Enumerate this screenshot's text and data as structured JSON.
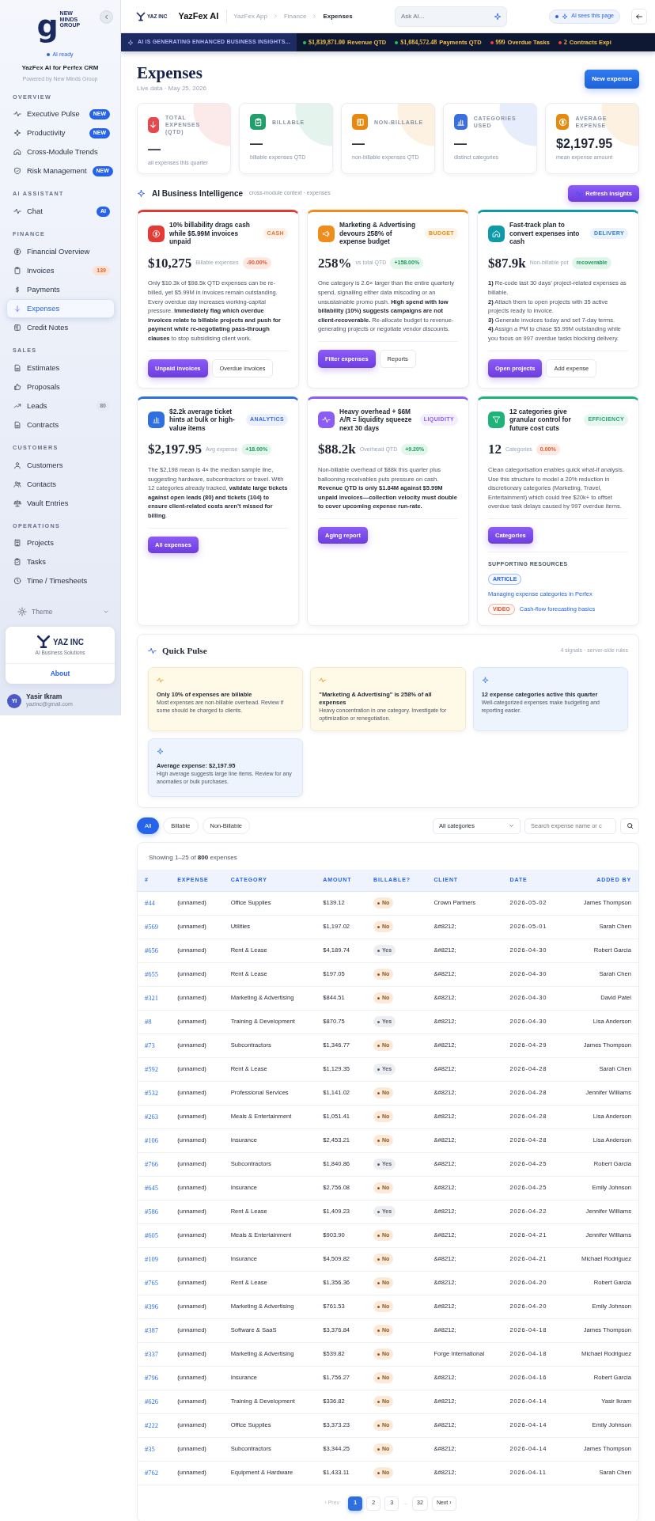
{
  "sidebar": {
    "logo": {
      "mark": "g",
      "text": "NEW MINDS GROUP"
    },
    "status": "AI ready",
    "app_name": "YazFex AI for Perfex CRM",
    "powered_by": "Powered by New Minds Group",
    "sections": [
      {
        "title": "OVERVIEW",
        "items": [
          {
            "label": "Executive Pulse",
            "selected": false,
            "badge": {
              "text": "NEW",
              "color": "#2563eb"
            }
          },
          {
            "label": "Productivity",
            "selected": false,
            "badge": {
              "text": "NEW",
              "color": "#2563eb"
            }
          },
          {
            "label": "Cross-Module Trends",
            "selected": false
          },
          {
            "label": "Risk Management",
            "selected": false,
            "badge": {
              "text": "NEW",
              "color": "#2563eb"
            }
          }
        ]
      },
      {
        "title": "AI ASSISTANT",
        "items": [
          {
            "label": "Chat",
            "selected": false,
            "badge": {
              "text": "AI",
              "color": "#2563eb"
            }
          }
        ]
      },
      {
        "title": "FINANCE",
        "items": [
          {
            "label": "Financial Overview",
            "selected": false
          },
          {
            "label": "Invoices",
            "selected": false,
            "badge": {
              "text": "139",
              "color": "#fbe2d3"
            }
          },
          {
            "label": "Payments",
            "selected": false
          },
          {
            "label": "Expenses",
            "selected": true
          },
          {
            "label": "Credit Notes",
            "selected": false
          }
        ]
      },
      {
        "title": "SALES",
        "items": [
          {
            "label": "Estimates",
            "selected": false
          },
          {
            "label": "Proposals",
            "selected": false
          },
          {
            "label": "Leads",
            "selected": false,
            "badge": {
              "text": "80",
              "color": "#e4e9f5"
            }
          },
          {
            "label": "Contracts",
            "selected": false
          }
        ]
      },
      {
        "title": "CUSTOMERS",
        "items": [
          {
            "label": "Customers",
            "selected": false
          },
          {
            "label": "Contacts",
            "selected": false
          },
          {
            "label": "Vault Entries",
            "selected": false
          }
        ]
      },
      {
        "title": "OPERATIONS",
        "items": [
          {
            "label": "Projects",
            "selected": false
          },
          {
            "label": "Tasks",
            "selected": false
          },
          {
            "label": "Time / Timesheets",
            "selected": false
          }
        ]
      }
    ],
    "theme_label": "Theme",
    "company": {
      "name": "YAZ INC",
      "tagline": "AI Business Solutions",
      "link": "About"
    },
    "user": {
      "initials": "YI",
      "name": "Yasir Ikram",
      "email": "yazinc@gmail.com"
    }
  },
  "header": {
    "logo_text": "YAZ INC",
    "app_title": "YazFex AI",
    "breadcrumb": [
      "YazFex App",
      "Finance",
      "Expenses"
    ],
    "search": {
      "placeholder": "Ask AI..."
    },
    "context_pill": "AI sees this page"
  },
  "ticker": {
    "label": "AI IS GENERATING ENHANCED BUSINESS INSIGHTS...",
    "items": [
      {
        "value": "$1,839,871.00",
        "label": "Revenue QTD",
        "color": "#22c55e"
      },
      {
        "value": "$1,084,572.48",
        "label": "Payments QTD",
        "color": "#22c55e"
      },
      {
        "value": "999",
        "label": "Overdue Tasks",
        "color": "#ef4444"
      },
      {
        "value": "2",
        "label": "Contracts Expi",
        "color": "#ef4444"
      }
    ]
  },
  "page": {
    "title": "Expenses",
    "subtitle": "Live data · May 25, 2026",
    "primary_button": "New expense"
  },
  "kpis": [
    {
      "label": "TOTAL EXPENSES (QTD)",
      "value": "—",
      "caption": "all expenses this quarter",
      "color": "#e5484d"
    },
    {
      "label": "BILLABLE",
      "value": "—",
      "caption": "billable expenses QTD",
      "color": "#22a06b"
    },
    {
      "label": "NON-BILLABLE",
      "value": "—",
      "caption": "non-billable expenses QTD",
      "color": "#e8890c"
    },
    {
      "label": "CATEGORIES USED",
      "value": "—",
      "caption": "distinct categories",
      "color": "#3b6fe0"
    },
    {
      "label": "AVERAGE EXPENSE",
      "value": "$2,197.95",
      "caption": "mean expense amount",
      "color": "#e8890c"
    }
  ],
  "ai": {
    "title": "AI Business Intelligence",
    "subtitle": "cross-module context · expenses",
    "button": "Refresh insights",
    "cards": [
      {
        "color": "#e53935",
        "tag": {
          "text": "CASH",
          "color": "#e8772e"
        },
        "title": "10% billability drags cash while $5.99M invoices unpaid",
        "value": "$10,275",
        "value_label": "Billable expenses",
        "delta": {
          "text": "-90.00%",
          "negative": true
        },
        "body": [
          "Only $10.3k of $98.5k QTD expenses can be re-billed, yet $5.99M in invoices remain outstanding. Every overdue day increases working-capital pressure. **Immediately flag which overdue invoices relate to billable projects and push for payment while re-negotiating pass-through clauses** to stop subsidising client work."
        ],
        "buttons": [
          {
            "label": "Unpaid invoices",
            "primary": true
          },
          {
            "label": "Overdue invoices",
            "primary": false
          }
        ]
      },
      {
        "color": "#f08c1c",
        "tag": {
          "text": "BUDGET",
          "color": "#e8890c"
        },
        "title": "Marketing & Advertising devours 258% of expense budget",
        "value": "258%",
        "value_label": "vs total QTD",
        "delta": {
          "text": "+158.00%",
          "negative": false
        },
        "body": [
          "One category is 2.6× larger than the entire quarterly spend, signalling either data miscoding or an unsustainable promo push. **High spend with low billability (10%) suggests campaigns are not client-recoverable.** Re-allocate budget to revenue-generating projects or negotiate vendor discounts."
        ],
        "buttons": [
          {
            "label": "Filter expenses",
            "primary": true
          },
          {
            "label": "Reports",
            "primary": false
          }
        ]
      },
      {
        "color": "#0e9aa7",
        "tag": {
          "text": "DELIVERY",
          "color": "#2f7fd0"
        },
        "title": "Fast-track plan to convert expenses into cash",
        "value": "$87.9k",
        "value_label": "Non-billable pot",
        "delta": {
          "text": "recoverable",
          "negative": false
        },
        "body": [
          "**1)** Re-code last 30 days’ project-related expenses as billable.",
          "**2)** Attach them to open projects with 35 active projects ready to invoice.",
          "**3)** Generate invoices today and set 7-day terms.",
          "**4)** Assign a PM to chase $5.99M outstanding while you focus on 997 overdue tasks blocking delivery."
        ],
        "buttons": [
          {
            "label": "Open projects",
            "primary": true
          },
          {
            "label": "Add expense",
            "primary": false
          }
        ]
      },
      {
        "color": "#2f6fe0",
        "tag": {
          "text": "ANALYTICS",
          "color": "#3b6fe0"
        },
        "title": "$2.2k average ticket hints at bulk or high-value items",
        "value": "$2,197.95",
        "value_label": "Avg expense",
        "delta": {
          "text": "+18.00%",
          "negative": false
        },
        "body": [
          "The $2,198 mean is 4× the median sample line, suggesting hardware, subcontractors or travel. With 12 categories already tracked, **validate large tickets against open leads (80) and tickets (104) to ensure client-related costs aren’t missed for billing**."
        ],
        "buttons": [
          {
            "label": "All expenses",
            "primary": true
          }
        ]
      },
      {
        "color": "#8b5cf6",
        "tag": {
          "text": "LIQUIDITY",
          "color": "#8b5cf6"
        },
        "title": "Heavy overhead + $6M A/R = liquidity squeeze next 30 days",
        "value": "$88.2k",
        "value_label": "Overhead QTD",
        "delta": {
          "text": "+9.20%",
          "negative": false
        },
        "body": [
          "Non-billable overhead of $88k this quarter plus ballooning receivables puts pressure on cash. **Revenue QTD is only $1.84M against $5.99M unpaid invoices—collection velocity must double to cover upcoming expense run-rate.**"
        ],
        "buttons": [
          {
            "label": "Aging report",
            "primary": true
          }
        ]
      },
      {
        "color": "#1fb37a",
        "tag": {
          "text": "EFFICIENCY",
          "color": "#1fa56f"
        },
        "title": "12 categories give granular control for future cost cuts",
        "value": "12",
        "value_label": "Categories",
        "delta": {
          "text": "0.00%",
          "negative": true
        },
        "body": [
          "Clean categorisation enables quick what-if analysis. Use this structure to model a 20% reduction in discretionary categories (Marketing, Travel, Entertainment) which could free $20k+ to offset overdue task delays caused by 997 overdue items."
        ],
        "buttons": [
          {
            "label": "Categories",
            "primary": true
          }
        ],
        "resources": {
          "heading": "SUPPORTING RESOURCES",
          "items": [
            {
              "kind": "article",
              "tag": "ARTICLE",
              "link": "Managing expense categories in Perfex"
            },
            {
              "kind": "video",
              "tag": "VIDEO",
              "link": "Cash-flow forecasting basics"
            }
          ]
        }
      }
    ]
  },
  "quick_pulse": {
    "title": "Quick Pulse",
    "meta": "4 signals · server-side rules",
    "items": [
      {
        "kind": "warning",
        "title": "Only 10% of expenses are billable",
        "text": "Most expenses are non-billable overhead. Review if some should be charged to clients."
      },
      {
        "kind": "warning",
        "title": "\"Marketing & Advertising\" is 258% of all expenses",
        "text": "Heavy concentration in one category. Investigate for optimization or renegotiation."
      },
      {
        "kind": "info",
        "title": "12 expense categories active this quarter",
        "text": "Well-categorized expenses make budgeting and reporting easier."
      },
      {
        "kind": "info",
        "title": "Average expense: $2,197.95",
        "text": "High average suggests large line items. Review for any anomalies or bulk purchases."
      }
    ]
  },
  "filters": {
    "tabs": [
      {
        "label": "All",
        "selected": true
      },
      {
        "label": "Billable",
        "selected": false
      },
      {
        "label": "Non-Billable",
        "selected": false
      }
    ],
    "category_select": "All categories",
    "search": {
      "placeholder": "Search expense name or c"
    }
  },
  "table": {
    "summary": "Showing 1–25 of **800** expenses",
    "columns": [
      "#",
      "EXPENSE",
      "CATEGORY",
      "AMOUNT",
      "BILLABLE?",
      "CLIENT",
      "DATE",
      "ADDED BY"
    ],
    "rows": [
      {
        "id": "#44",
        "expense": "(unnamed)",
        "category": "Office Supplies",
        "amount": "$139.12",
        "billable": false,
        "billable_text": "No",
        "client": "Crown Partners",
        "date": "2026-05-02",
        "added_by": "James Thompson"
      },
      {
        "id": "#569",
        "expense": "(unnamed)",
        "category": "Utilities",
        "amount": "$1,197.02",
        "billable": false,
        "billable_text": "No",
        "client": "&#8212;",
        "date": "2026-05-01",
        "added_by": "Sarah Chen"
      },
      {
        "id": "#656",
        "expense": "(unnamed)",
        "category": "Rent & Lease",
        "amount": "$4,189.74",
        "billable": true,
        "billable_text": "Yes",
        "client": "&#8212;",
        "date": "2026-04-30",
        "added_by": "Robert Garcia"
      },
      {
        "id": "#655",
        "expense": "(unnamed)",
        "category": "Rent & Lease",
        "amount": "$197.05",
        "billable": false,
        "billable_text": "No",
        "client": "&#8212;",
        "date": "2026-04-30",
        "added_by": "Sarah Chen"
      },
      {
        "id": "#321",
        "expense": "(unnamed)",
        "category": "Marketing & Advertising",
        "amount": "$844.51",
        "billable": false,
        "billable_text": "No",
        "client": "&#8212;",
        "date": "2026-04-30",
        "added_by": "David Patel"
      },
      {
        "id": "#8",
        "expense": "(unnamed)",
        "category": "Training & Development",
        "amount": "$870.75",
        "billable": true,
        "billable_text": "Yes",
        "client": "&#8212;",
        "date": "2026-04-30",
        "added_by": "Lisa Anderson"
      },
      {
        "id": "#73",
        "expense": "(unnamed)",
        "category": "Subcontractors",
        "amount": "$1,346.77",
        "billable": false,
        "billable_text": "No",
        "client": "&#8212;",
        "date": "2026-04-29",
        "added_by": "James Thompson"
      },
      {
        "id": "#592",
        "expense": "(unnamed)",
        "category": "Rent & Lease",
        "amount": "$1,129.35",
        "billable": true,
        "billable_text": "Yes",
        "client": "&#8212;",
        "date": "2026-04-28",
        "added_by": "Sarah Chen"
      },
      {
        "id": "#532",
        "expense": "(unnamed)",
        "category": "Professional Services",
        "amount": "$1,141.02",
        "billable": false,
        "billable_text": "No",
        "client": "&#8212;",
        "date": "2026-04-28",
        "added_by": "Jennifer Williams"
      },
      {
        "id": "#263",
        "expense": "(unnamed)",
        "category": "Meals & Entertainment",
        "amount": "$1,051.41",
        "billable": false,
        "billable_text": "No",
        "client": "&#8212;",
        "date": "2026-04-28",
        "added_by": "Lisa Anderson"
      },
      {
        "id": "#106",
        "expense": "(unnamed)",
        "category": "Insurance",
        "amount": "$2,453.21",
        "billable": false,
        "billable_text": "No",
        "client": "&#8212;",
        "date": "2026-04-28",
        "added_by": "Lisa Anderson"
      },
      {
        "id": "#766",
        "expense": "(unnamed)",
        "category": "Subcontractors",
        "amount": "$1,840.86",
        "billable": true,
        "billable_text": "Yes",
        "client": "&#8212;",
        "date": "2026-04-25",
        "added_by": "Robert Garcia"
      },
      {
        "id": "#645",
        "expense": "(unnamed)",
        "category": "Insurance",
        "amount": "$2,756.08",
        "billable": false,
        "billable_text": "No",
        "client": "&#8212;",
        "date": "2026-04-25",
        "added_by": "Emily Johnson"
      },
      {
        "id": "#586",
        "expense": "(unnamed)",
        "category": "Rent & Lease",
        "amount": "$1,409.23",
        "billable": true,
        "billable_text": "Yes",
        "client": "&#8212;",
        "date": "2026-04-22",
        "added_by": "Jennifer Williams"
      },
      {
        "id": "#605",
        "expense": "(unnamed)",
        "category": "Meals & Entertainment",
        "amount": "$903.90",
        "billable": false,
        "billable_text": "No",
        "client": "&#8212;",
        "date": "2026-04-21",
        "added_by": "Jennifer Williams"
      },
      {
        "id": "#109",
        "expense": "(unnamed)",
        "category": "Insurance",
        "amount": "$4,509.82",
        "billable": false,
        "billable_text": "No",
        "client": "&#8212;",
        "date": "2026-04-21",
        "added_by": "Michael Rodriguez"
      },
      {
        "id": "#765",
        "expense": "(unnamed)",
        "category": "Rent & Lease",
        "amount": "$1,356.36",
        "billable": false,
        "billable_text": "No",
        "client": "&#8212;",
        "date": "2026-04-20",
        "added_by": "Robert Garcia"
      },
      {
        "id": "#396",
        "expense": "(unnamed)",
        "category": "Marketing & Advertising",
        "amount": "$761.53",
        "billable": false,
        "billable_text": "No",
        "client": "&#8212;",
        "date": "2026-04-20",
        "added_by": "Emily Johnson"
      },
      {
        "id": "#387",
        "expense": "(unnamed)",
        "category": "Software & SaaS",
        "amount": "$3,376.84",
        "billable": false,
        "billable_text": "No",
        "client": "&#8212;",
        "date": "2026-04-18",
        "added_by": "James Thompson"
      },
      {
        "id": "#337",
        "expense": "(unnamed)",
        "category": "Marketing & Advertising",
        "amount": "$539.82",
        "billable": false,
        "billable_text": "No",
        "client": "Forge International",
        "date": "2026-04-18",
        "added_by": "Michael Rodriguez"
      },
      {
        "id": "#796",
        "expense": "(unnamed)",
        "category": "Insurance",
        "amount": "$1,756.27",
        "billable": false,
        "billable_text": "No",
        "client": "&#8212;",
        "date": "2026-04-16",
        "added_by": "Robert Garcia"
      },
      {
        "id": "#626",
        "expense": "(unnamed)",
        "category": "Training & Development",
        "amount": "$336.82",
        "billable": false,
        "billable_text": "No",
        "client": "&#8212;",
        "date": "2026-04-14",
        "added_by": "Yasir Ikram"
      },
      {
        "id": "#222",
        "expense": "(unnamed)",
        "category": "Office Supplies",
        "amount": "$3,373.23",
        "billable": false,
        "billable_text": "No",
        "client": "&#8212;",
        "date": "2026-04-14",
        "added_by": "Emily Johnson"
      },
      {
        "id": "#35",
        "expense": "(unnamed)",
        "category": "Subcontractors",
        "amount": "$3,344.25",
        "billable": false,
        "billable_text": "No",
        "client": "&#8212;",
        "date": "2026-04-14",
        "added_by": "James Thompson"
      },
      {
        "id": "#762",
        "expense": "(unnamed)",
        "category": "Equipment & Hardware",
        "amount": "$1,433.11",
        "billable": false,
        "billable_text": "No",
        "client": "&#8212;",
        "date": "2026-04-11",
        "added_by": "Sarah Chen"
      }
    ]
  },
  "pagination": {
    "prev": {
      "label": "‹ Prev",
      "disabled": true
    },
    "pages": [
      {
        "label": "1",
        "selected": true
      },
      {
        "label": "2",
        "selected": false
      },
      {
        "label": "3",
        "selected": false
      },
      {
        "label": "…",
        "kind": "gap"
      },
      {
        "label": "32",
        "selected": false
      }
    ],
    "next": {
      "label": "Next ›",
      "disabled": false
    }
  }
}
